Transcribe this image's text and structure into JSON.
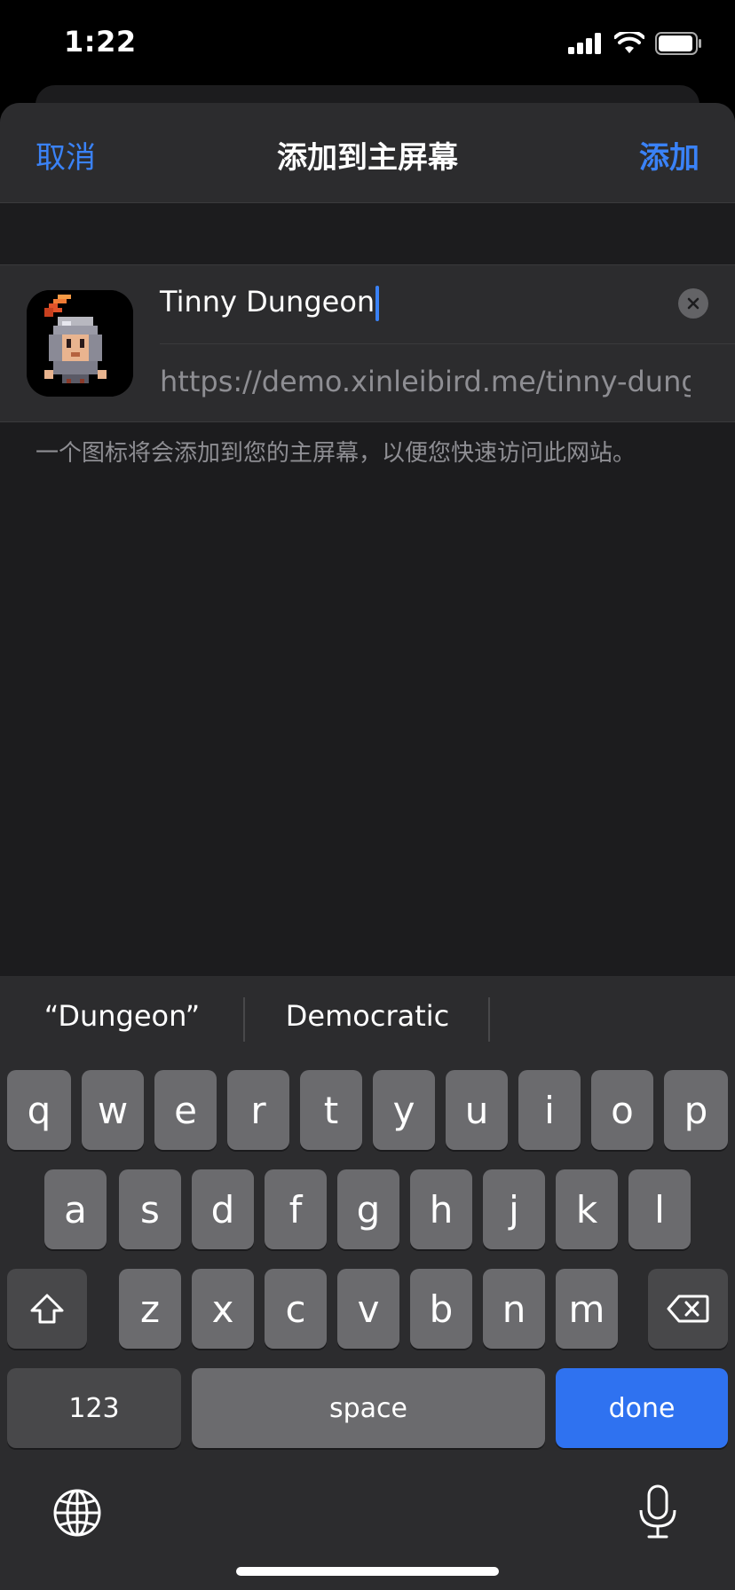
{
  "status_bar": {
    "time": "1:22"
  },
  "nav": {
    "cancel": "取消",
    "title": "添加到主屏幕",
    "add": "添加"
  },
  "bookmark": {
    "name": "Tinny Dungeon",
    "url": "https://demo.xinleibird.me/tinny-dung..."
  },
  "help_text": "一个图标将会添加到您的主屏幕，以便您快速访问此网站。",
  "keyboard": {
    "suggestions": [
      "“Dungeon”",
      "Democratic"
    ],
    "row1": [
      "q",
      "w",
      "e",
      "r",
      "t",
      "y",
      "u",
      "i",
      "o",
      "p"
    ],
    "row2": [
      "a",
      "s",
      "d",
      "f",
      "g",
      "h",
      "j",
      "k",
      "l"
    ],
    "row3": [
      "z",
      "x",
      "c",
      "v",
      "b",
      "n",
      "m"
    ],
    "numbers_key": "123",
    "space_key": "space",
    "done_key": "done"
  },
  "colors": {
    "accent": "#3a82f7",
    "done": "#2f72f0"
  }
}
